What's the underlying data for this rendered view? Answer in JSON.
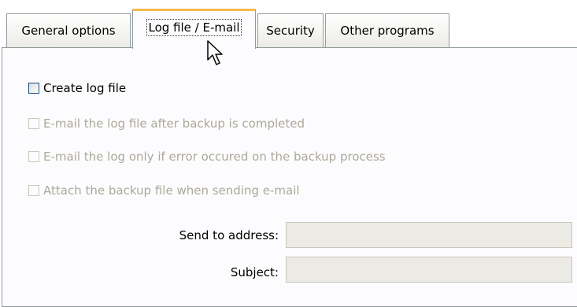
{
  "tabs": [
    {
      "label": "General options",
      "active": false
    },
    {
      "label": "Log file / E-mail",
      "active": true
    },
    {
      "label": "Security",
      "active": false
    },
    {
      "label": "Other programs",
      "active": false
    }
  ],
  "options": [
    {
      "label": "Create log file",
      "checked": false,
      "enabled": true
    },
    {
      "label": "E-mail the log file after backup is completed",
      "checked": false,
      "enabled": false
    },
    {
      "label": "E-mail the log only if error occured on the backup process",
      "checked": false,
      "enabled": false
    },
    {
      "label": "Attach the backup file when sending e-mail",
      "checked": false,
      "enabled": false
    }
  ],
  "fields": {
    "send_to": {
      "label": "Send to address:",
      "value": ""
    },
    "subject": {
      "label": "Subject:",
      "value": ""
    }
  },
  "colors": {
    "active_tab_accent": "#f6b94c",
    "disabled_text": "#aca899",
    "border": "#919b9c",
    "disabled_field_bg": "#ebeae4"
  },
  "icons": {
    "cursor": "mouse-pointer-icon"
  }
}
